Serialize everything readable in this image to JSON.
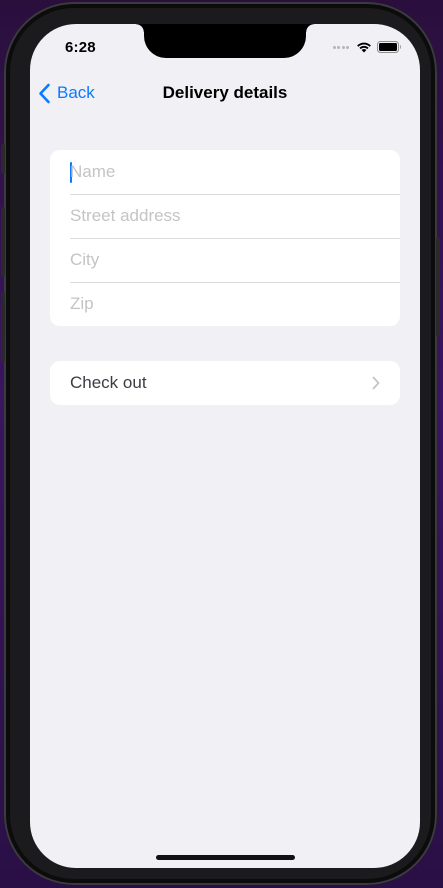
{
  "status_bar": {
    "time": "6:28"
  },
  "nav": {
    "back_label": "Back",
    "title": "Delivery details"
  },
  "form": {
    "fields": [
      {
        "placeholder": "Name",
        "value": ""
      },
      {
        "placeholder": "Street address",
        "value": ""
      },
      {
        "placeholder": "City",
        "value": ""
      },
      {
        "placeholder": "Zip",
        "value": ""
      }
    ]
  },
  "checkout": {
    "label": "Check out"
  },
  "colors": {
    "accent": "#0a7aff",
    "background": "#f0f0f5",
    "placeholder": "#c4c4c7"
  }
}
